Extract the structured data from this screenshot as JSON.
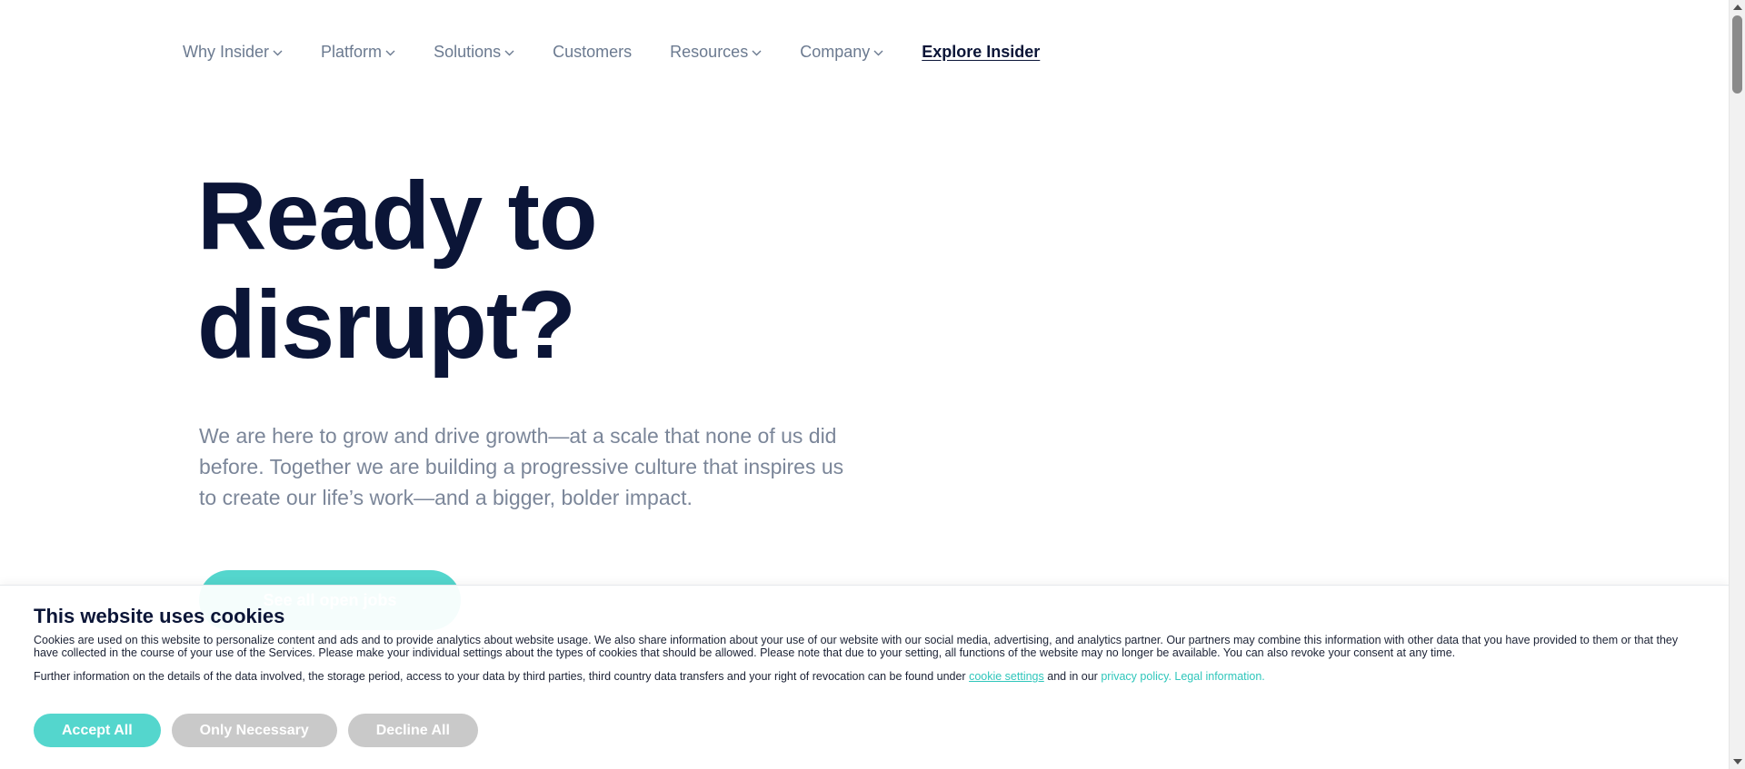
{
  "nav": {
    "items": [
      {
        "label": "Why Insider",
        "has_dropdown": true
      },
      {
        "label": "Platform",
        "has_dropdown": true
      },
      {
        "label": "Solutions",
        "has_dropdown": true
      },
      {
        "label": "Customers",
        "has_dropdown": false
      },
      {
        "label": "Resources",
        "has_dropdown": true
      },
      {
        "label": "Company",
        "has_dropdown": true
      }
    ],
    "explore_label": "Explore Insider"
  },
  "hero": {
    "title_line1": "Ready to",
    "title_line2": "disrupt?",
    "subtitle": "We are here to grow and drive growth—at a scale that none of us did before. Together we are building a progressive culture that inspires us to create our life’s work—and a bigger, bolder impact.",
    "cta_label": "See all open jobs"
  },
  "cookie_banner": {
    "title": "This website uses cookies",
    "body": "Cookies are used on this website to personalize content and ads and to provide analytics about website usage. We also share information about your use of our website with our social media, advertising, and analytics partner. Our partners may combine this information with other data that you have provided to them or that they have collected in the course of your use of the Services. Please make your individual settings about the types of cookies that should be allowed. Please note that due to your setting, all functions of the website may no longer be available. You can also revoke your consent at any time.",
    "further_prefix": "Further information on the details of the data involved, the storage period, access to your data by third parties, third country data transfers and your right of revocation can be found under",
    "cookie_settings_link": "cookie settings",
    "and_text": "and in our",
    "privacy_link": "privacy policy.",
    "legal_link": "Legal information.",
    "buttons": {
      "accept_all": "Accept All",
      "only_necessary": "Only Necessary",
      "decline_all": "Decline All"
    }
  },
  "colors": {
    "brand_navy": "#0b1537",
    "accent_teal": "#54d6cd",
    "muted_text": "#7b8699",
    "neutral_button": "#c9c9c9"
  }
}
